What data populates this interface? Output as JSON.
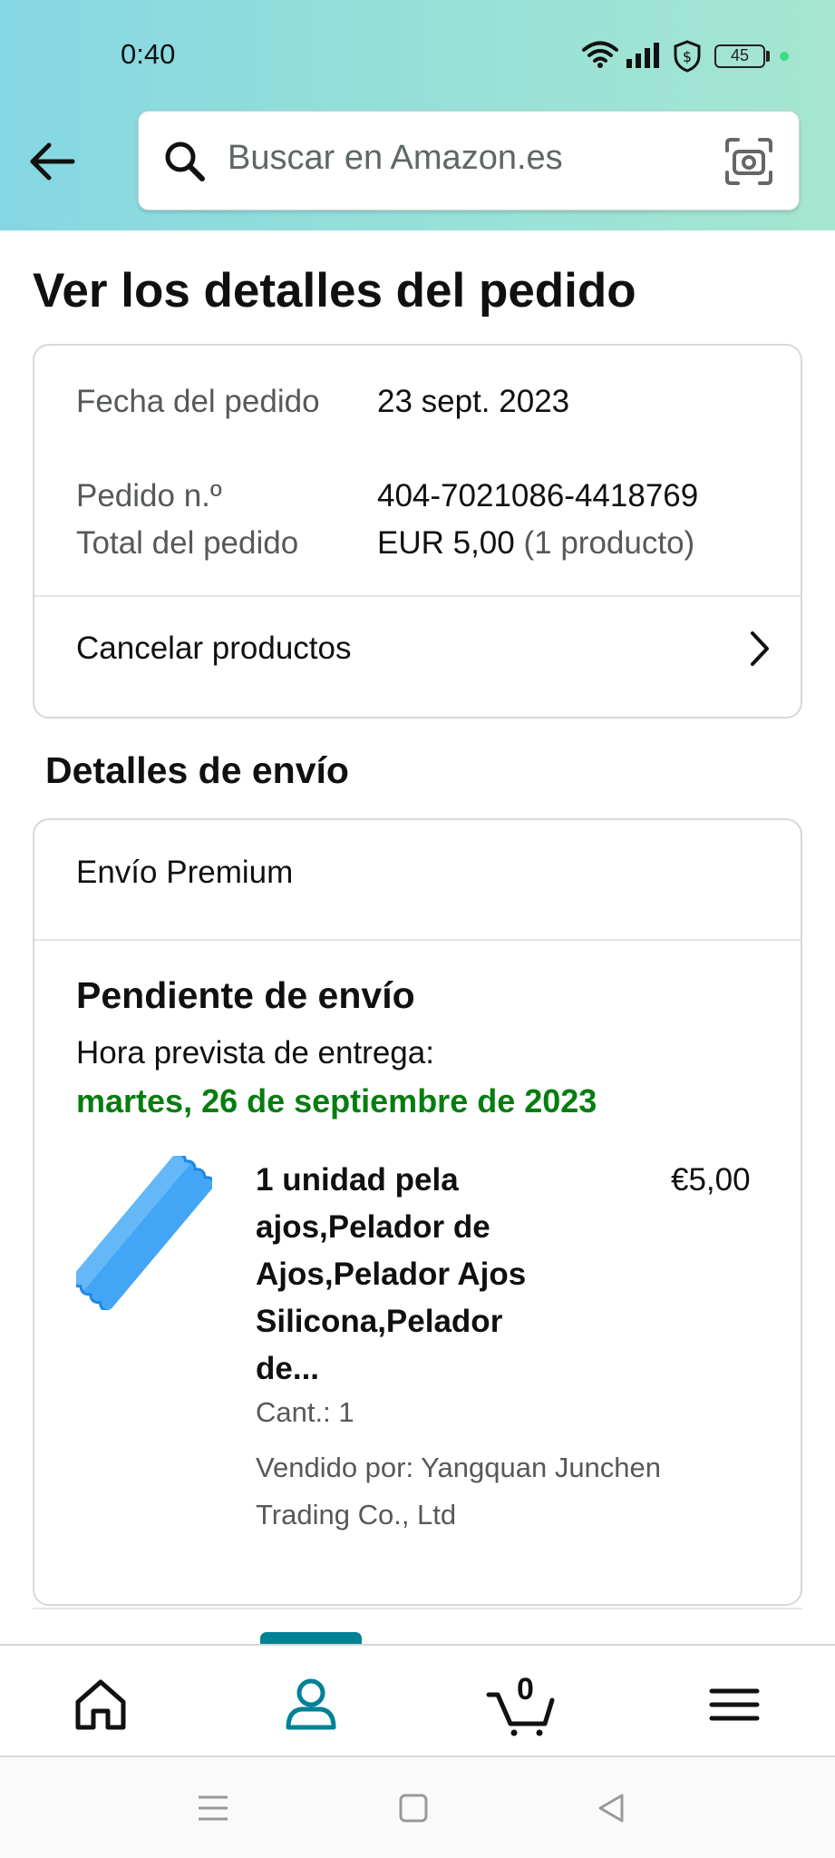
{
  "status_bar": {
    "time": "0:40",
    "battery": "45"
  },
  "search": {
    "placeholder": "Buscar en Amazon.es"
  },
  "page": {
    "title": "Ver los detalles del pedido"
  },
  "order": {
    "date_label": "Fecha del pedido",
    "date_value": "23 sept. 2023",
    "number_label": "Pedido n.º",
    "number_value": "404-7021086-4418769",
    "total_label": "Total del pedido",
    "total_value": "EUR 5,00",
    "total_count": "(1 producto)",
    "cancel_label": "Cancelar productos"
  },
  "shipping": {
    "section_title": "Detalles de envío",
    "method": "Envío Premium",
    "status": "Pendiente de envío",
    "expected_label": "Hora prevista de entrega:",
    "expected_date": "martes, 26 de septiembre de 2023",
    "product": {
      "title": "1 unidad pela ajos,Pelador de Ajos,Pelador Ajos Silicona,Pelador de...",
      "price": "€5,00",
      "quantity": "Cant.: 1",
      "seller": "Vendido por: Yangquan Junchen Trading Co., Ltd",
      "image_color": "#42a5f5"
    }
  },
  "bottom_nav": {
    "active": "account",
    "cart_count": "0",
    "accent_color": "#008296"
  }
}
